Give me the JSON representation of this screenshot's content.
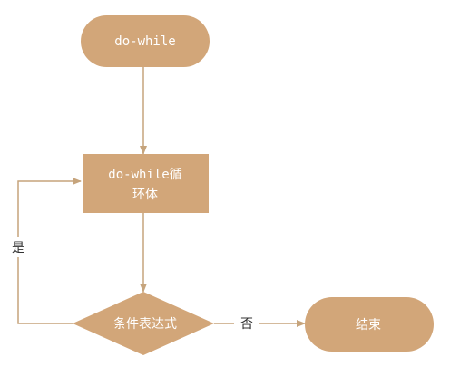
{
  "colors": {
    "node_fill": "#d2a679",
    "edge": "#c6a47c",
    "node_text": "#ffffff",
    "label_text": "#333333"
  },
  "nodes": {
    "start": {
      "label": "do-while",
      "shape": "rounded-rect"
    },
    "body": {
      "line1": "do-while循",
      "line2": "环体",
      "shape": "rect"
    },
    "condition": {
      "label": "条件表达式",
      "shape": "diamond"
    },
    "end": {
      "label": "结束",
      "shape": "rounded-rect"
    }
  },
  "edges": {
    "yes_label": "是",
    "no_label": "否"
  }
}
